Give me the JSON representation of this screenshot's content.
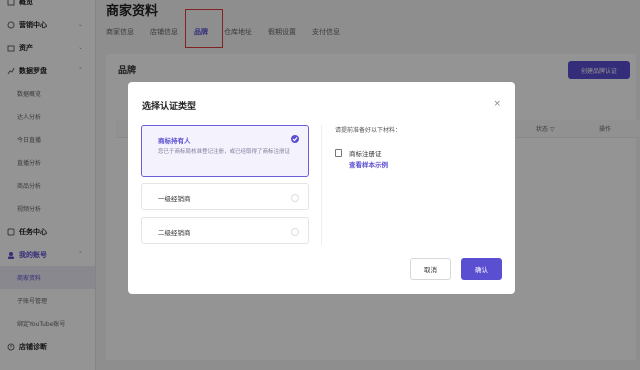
{
  "sidebar": {
    "groups": [
      {
        "label": "概览",
        "icon": "overview-icon"
      },
      {
        "label": "营销中心",
        "icon": "marketing-icon"
      },
      {
        "label": "资产",
        "icon": "assets-icon"
      },
      {
        "label": "数据罗盘",
        "icon": "compass-icon"
      }
    ],
    "data_items": [
      "数据概览",
      "达人分析",
      "今日直播",
      "直播分析",
      "商品分析",
      "视频分析"
    ],
    "groups2": [
      {
        "label": "任务中心",
        "icon": "task-icon"
      },
      {
        "label": "我的账号",
        "icon": "account-icon"
      }
    ],
    "account_items": [
      "商家资料",
      "子账号管理",
      "绑定YouTube账号"
    ],
    "footer_group": {
      "label": "店铺诊断",
      "icon": "diagnosis-icon"
    }
  },
  "page": {
    "title": "商家资料",
    "tabs": [
      "商家信息",
      "店铺信息",
      "品牌",
      "仓库地址",
      "假期设置",
      "支付信息"
    ],
    "active_tab": "品牌"
  },
  "panel": {
    "title": "品牌",
    "create_button": "创建品牌认证",
    "headers": {
      "status": "状态 ▽",
      "action": "操作"
    }
  },
  "modal": {
    "title": "选择认证类型",
    "close_symbol": "×",
    "options": [
      {
        "label": "商标持有人",
        "desc": "您已于商标局核准登记注册，或已经取得了商标注册证",
        "selected": true
      },
      {
        "label": "一级经销商"
      },
      {
        "label": "二级经销商"
      }
    ],
    "requirements_title": "请提前准备好以下材料：",
    "document_name": "商标注册证",
    "document_link": "查看样本示例",
    "cancel_label": "取消",
    "confirm_label": "确认"
  },
  "colors": {
    "accent": "#5b4fd1",
    "highlight_box": "#e23b3b"
  }
}
